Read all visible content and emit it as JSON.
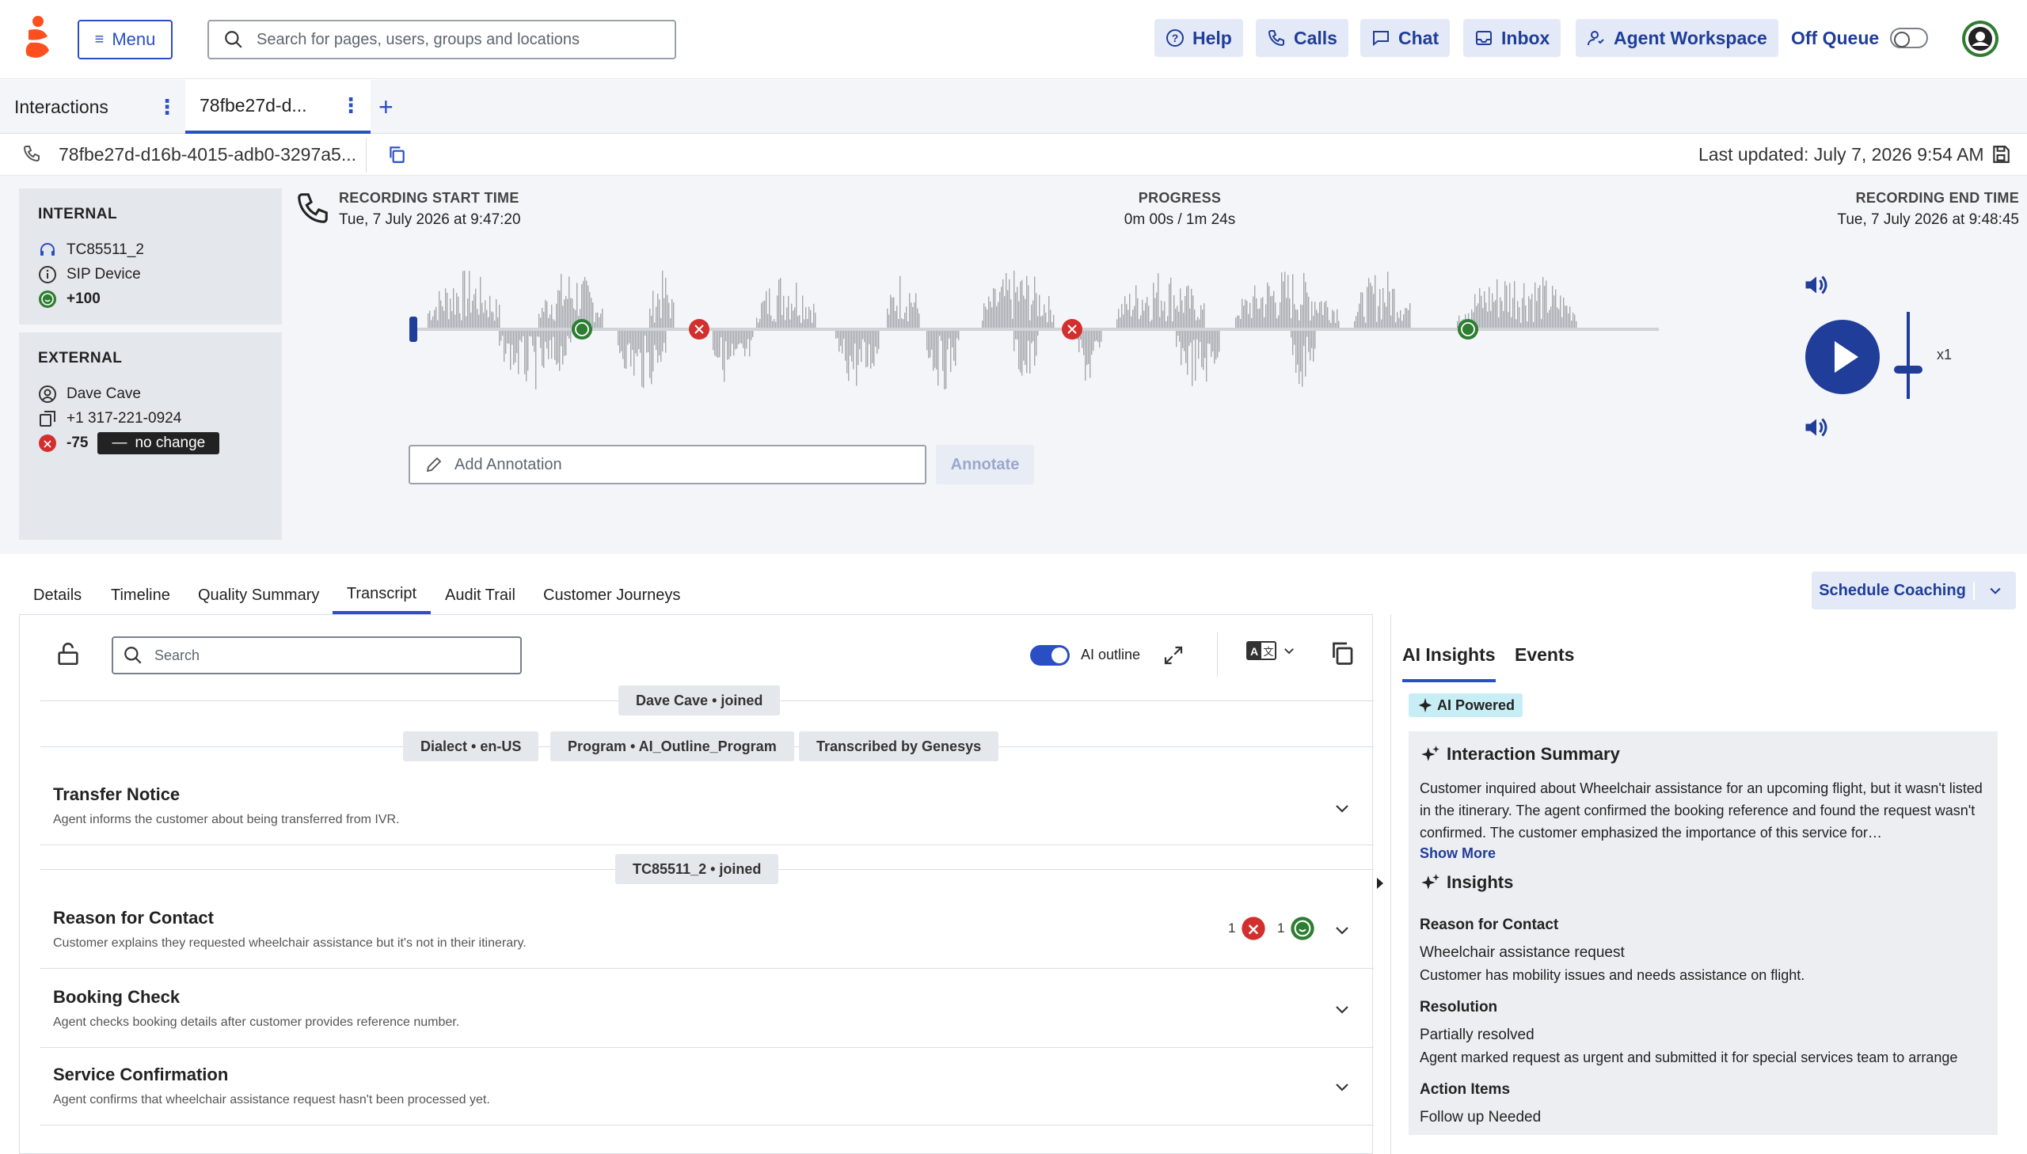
{
  "topbar": {
    "menu_label": "Menu",
    "search_placeholder": "Search for pages, users, groups and locations",
    "help": "Help",
    "calls": "Calls",
    "chat": "Chat",
    "inbox": "Inbox",
    "agent_workspace": "Agent Workspace",
    "off_queue": "Off Queue"
  },
  "tabs": {
    "interactions": "Interactions",
    "current": "78fbe27d-d...",
    "add": "+"
  },
  "id_row": {
    "conversation_id": "78fbe27d-d16b-4015-adb0-3297a5...",
    "last_updated": "Last updated: July 7, 2026 9:54 AM"
  },
  "internal": {
    "heading": "INTERNAL",
    "agent": "TC85511_2",
    "device": "SIP Device",
    "sentiment": "+100"
  },
  "external": {
    "heading": "EXTERNAL",
    "name": "Dave Cave",
    "phone": "+1 317-221-0924",
    "sentiment": "-75",
    "change": "no change"
  },
  "recording": {
    "start_label": "RECORDING START TIME",
    "start_value": "Tue, 7 July 2026 at 9:47:20",
    "progress_label": "PROGRESS",
    "progress_value": "0m 00s / 1m 24s",
    "end_label": "RECORDING END TIME",
    "end_value": "Tue, 7 July 2026 at 9:48:45",
    "speed": "x1",
    "annotation_placeholder": "Add Annotation",
    "annotate_button": "Annotate"
  },
  "subtabs": {
    "details": "Details",
    "timeline": "Timeline",
    "quality": "Quality Summary",
    "transcript": "Transcript",
    "audit": "Audit Trail",
    "journeys": "Customer Journeys",
    "schedule": "Schedule Coaching"
  },
  "transcript": {
    "search_placeholder": "Search",
    "ai_outline": "AI outline",
    "joined_customer": "Dave Cave • joined",
    "dialect": "Dialect • en-US",
    "program": "Program • AI_Outline_Program",
    "transcribed": "Transcribed by Genesys",
    "joined_agent": "TC85511_2 • joined",
    "sections": [
      {
        "title": "Transfer Notice",
        "desc": "Agent informs the customer about being transferred from IVR."
      },
      {
        "title": "Reason for Contact",
        "desc": "Customer explains they requested wheelchair assistance but it's not in their itinerary.",
        "neg": "1",
        "pos": "1"
      },
      {
        "title": "Booking Check",
        "desc": "Agent checks booking details after customer provides reference number."
      },
      {
        "title": "Service Confirmation",
        "desc": "Agent confirms that wheelchair assistance request hasn't been processed yet."
      }
    ]
  },
  "insights": {
    "tab_ai": "AI Insights",
    "tab_events": "Events",
    "badge": "AI Powered",
    "summary_title": "Interaction Summary",
    "summary_text": "Customer inquired about Wheelchair assistance for an upcoming flight, but it wasn't listed in the itinerary. The agent confirmed the booking reference and found the request wasn't confirmed. The customer emphasized the importance of this service for…",
    "show_more": "Show More",
    "insights_title": "Insights",
    "reason_label": "Reason for Contact",
    "reason_value": "Wheelchair assistance request",
    "reason_detail": "Customer has mobility issues and needs assistance on flight.",
    "resolution_label": "Resolution",
    "resolution_value": "Partially resolved",
    "resolution_detail": "Agent marked request as urgent and submitted it for special services team to arrange",
    "action_label": "Action Items",
    "action_value": "Follow up Needed"
  },
  "colors": {
    "accent": "#2a4fc4",
    "positive": "#2e7d32",
    "negative": "#d32f2f",
    "brand": "#ff4f1f"
  }
}
